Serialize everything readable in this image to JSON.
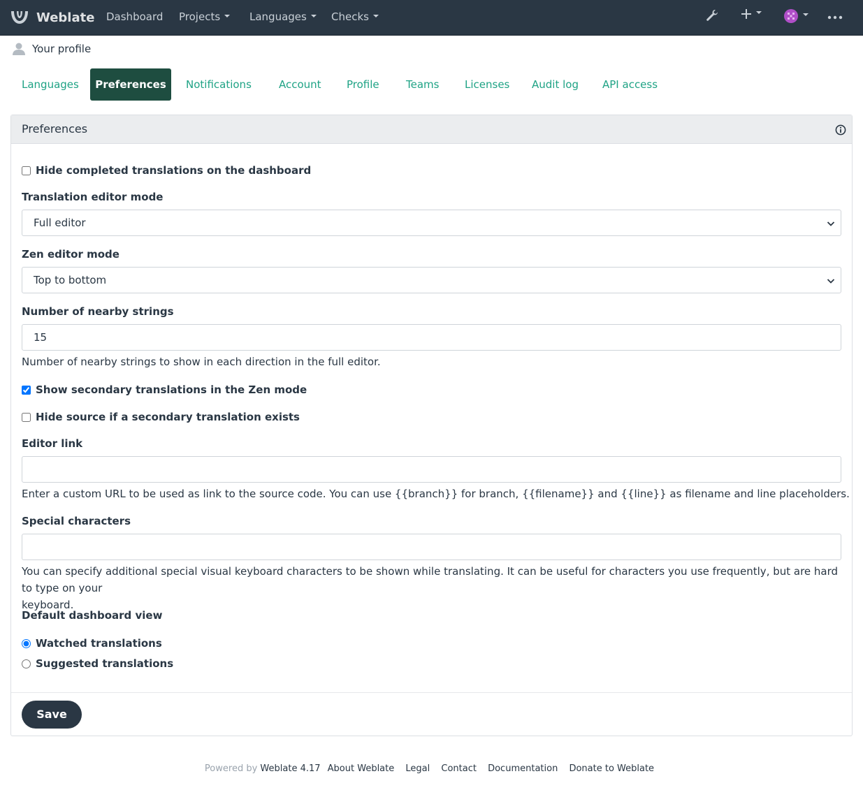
{
  "navbar": {
    "brand": "Weblate",
    "items": [
      {
        "label": "Dashboard",
        "dropdown": false
      },
      {
        "label": "Projects",
        "dropdown": true
      },
      {
        "label": "Languages",
        "dropdown": true
      },
      {
        "label": "Checks",
        "dropdown": true
      }
    ],
    "right_icons": [
      "wrench-icon",
      "plus-icon",
      "avatar",
      "more-icon"
    ]
  },
  "breadcrumb": {
    "label": "Your profile"
  },
  "tabs": [
    "Languages",
    "Preferences",
    "Notifications",
    "Account",
    "Profile",
    "Teams",
    "Licenses",
    "Audit log",
    "API access"
  ],
  "active_tab": "Preferences",
  "panel": {
    "title": "Preferences",
    "hide_completed": {
      "label": "Hide completed translations on the dashboard",
      "checked": false
    },
    "editor_mode": {
      "label": "Translation editor mode",
      "value": "Full editor"
    },
    "zen_mode": {
      "label": "Zen editor mode",
      "value": "Top to bottom"
    },
    "nearby": {
      "label": "Number of nearby strings",
      "value": "15",
      "help": "Number of nearby strings to show in each direction in the full editor."
    },
    "show_secondary": {
      "label": "Show secondary translations in the Zen mode",
      "checked": true
    },
    "hide_source": {
      "label": "Hide source if a secondary translation exists",
      "checked": false
    },
    "editor_link": {
      "label": "Editor link",
      "value": "",
      "help": "Enter a custom URL to be used as link to the source code. You can use {{branch}} for branch, {{filename}} and {{line}} as filename and line placeholders."
    },
    "special_chars": {
      "label": "Special characters",
      "value": "",
      "help_line1": "You can specify additional special visual keyboard characters to be shown while translating. It can be useful for characters you use frequently, but are hard to type on your",
      "help_line2": "keyboard."
    },
    "dashboard_view": {
      "label": "Default dashboard view",
      "options": [
        {
          "label": "Watched translations",
          "selected": true
        },
        {
          "label": "Suggested translations",
          "selected": false
        }
      ]
    },
    "save_label": "Save"
  },
  "footer": {
    "powered_by": "Powered by",
    "version": "Weblate 4.17",
    "links": [
      "About Weblate",
      "Legal",
      "Contact",
      "Documentation",
      "Donate to Weblate"
    ]
  },
  "colors": {
    "navbar": "#2a3744",
    "accent": "#1fa385",
    "active_tab": "#1e4d40"
  }
}
